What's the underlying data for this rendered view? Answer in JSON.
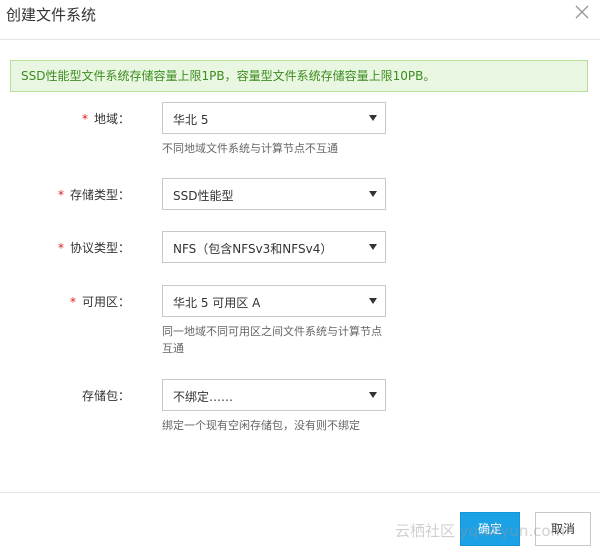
{
  "dialog": {
    "title": "创建文件系统"
  },
  "notice": {
    "text": "SSD性能型文件系统存储容量上限1PB，容量型文件系统存储容量上限10PB。"
  },
  "form": {
    "required_mark": "*",
    "region": {
      "label": "地域：",
      "value": "华北 5",
      "help": "不同地域文件系统与计算节点不互通"
    },
    "storage_type": {
      "label": "存储类型：",
      "value": "SSD性能型"
    },
    "protocol": {
      "label": "协议类型：",
      "value": "NFS（包含NFSv3和NFSv4）"
    },
    "zone": {
      "label": "可用区：",
      "value": "华北 5 可用区 A",
      "help": "同一地域不同可用区之间文件系统与计算节点互通"
    },
    "storage_package": {
      "label": "存储包：",
      "value": "不绑定……",
      "help": "绑定一个现有空闲存储包，没有则不绑定"
    }
  },
  "footer": {
    "ok_label": "确定",
    "cancel_label": "取消"
  },
  "watermark": {
    "text": "云栖社区 yq.aliyun.com"
  },
  "icons": {
    "close": "close-icon",
    "caret": "caret-down-icon"
  },
  "colors": {
    "primary": "#1ba1e6",
    "notice_bg": "#e9f6e1",
    "notice_text": "#3c8d1f",
    "required": "#e02020"
  }
}
